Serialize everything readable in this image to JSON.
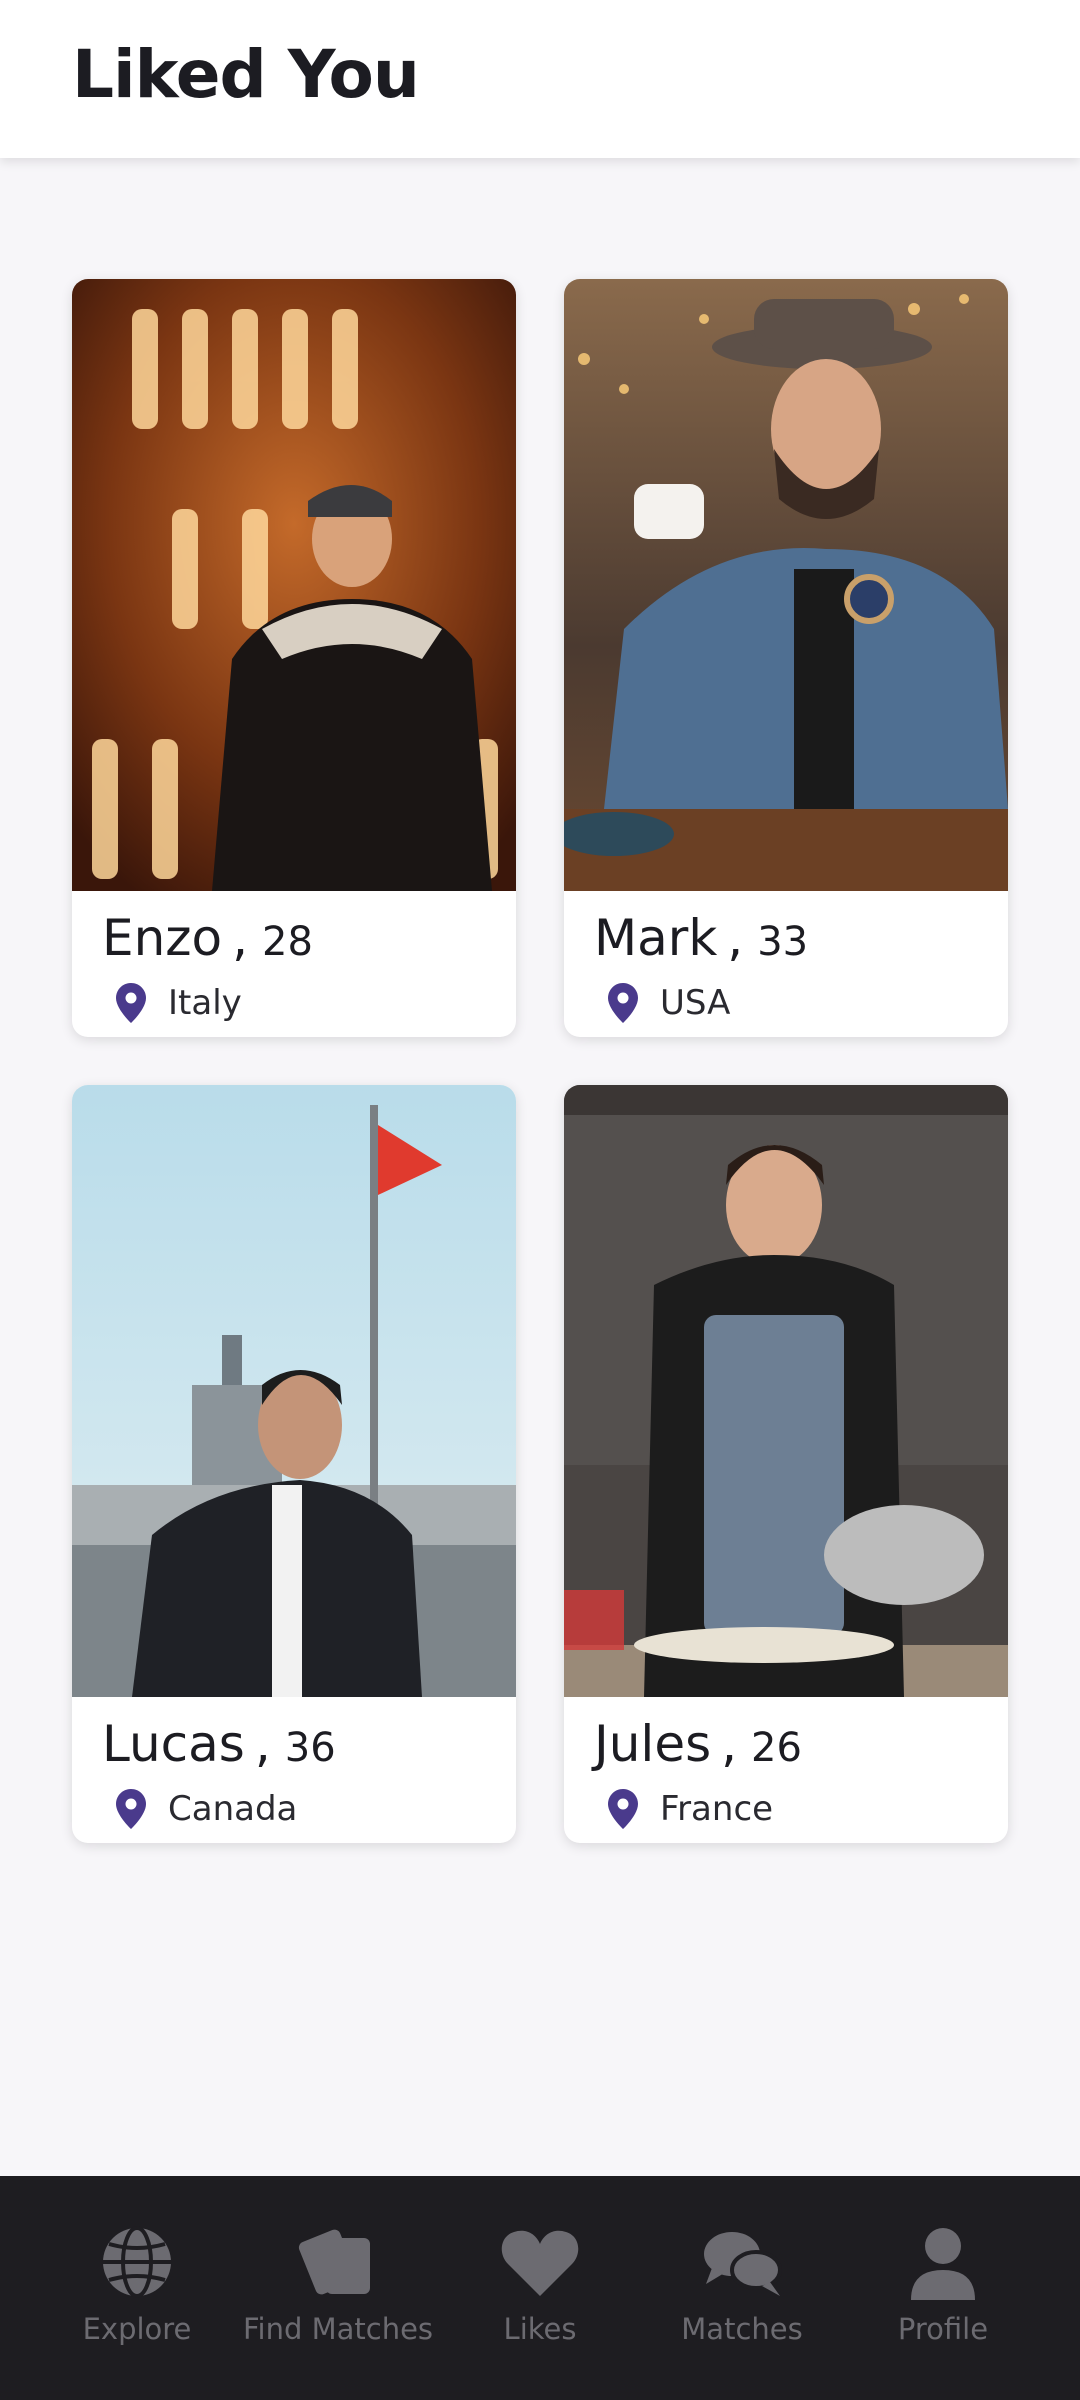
{
  "header": {
    "title": "Liked You"
  },
  "cards": [
    {
      "name": "Enzo",
      "separator": ",",
      "age": "28",
      "country": "Italy",
      "photo_icon": "portrait-photo"
    },
    {
      "name": "Mark",
      "separator": ",",
      "age": "33",
      "country": "USA",
      "photo_icon": "portrait-photo"
    },
    {
      "name": "Lucas",
      "separator": ",",
      "age": "36",
      "country": "Canada",
      "photo_icon": "portrait-photo"
    },
    {
      "name": "Jules",
      "separator": ",",
      "age": "26",
      "country": "France",
      "photo_icon": "portrait-photo"
    }
  ],
  "nav": {
    "explore": {
      "label": "Explore",
      "icon": "globe-icon"
    },
    "find_matches": {
      "label": "Find Matches",
      "icon": "cards-icon"
    },
    "likes": {
      "label": "Likes",
      "icon": "heart-icon"
    },
    "matches": {
      "label": "Matches",
      "icon": "chat-bubbles-icon"
    },
    "profile": {
      "label": "Profile",
      "icon": "user-icon"
    }
  },
  "colors": {
    "accent": "#4a3a8c",
    "nav_background": "#1e1d21",
    "nav_inactive": "#6c6b71",
    "page_background": "#f7f6f9"
  }
}
